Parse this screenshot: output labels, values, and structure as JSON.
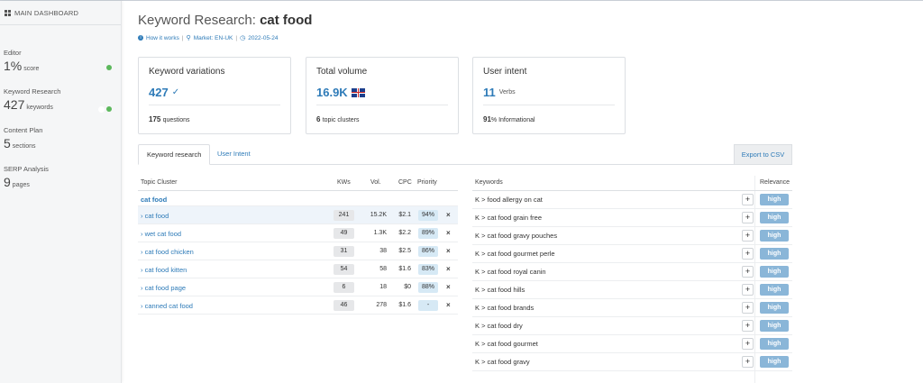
{
  "sidebar": {
    "dashboard_label": "MAIN DASHBOARD",
    "items": [
      {
        "label": "Editor",
        "value": "1%",
        "unit": "score"
      },
      {
        "label": "Keyword Research",
        "value": "427",
        "unit": "keywords"
      },
      {
        "label": "Content Plan",
        "value": "5",
        "unit": "sections"
      },
      {
        "label": "SERP Analysis",
        "value": "9",
        "unit": "pages"
      }
    ]
  },
  "header": {
    "title_prefix": "Keyword Research:",
    "title_keyword": "cat food",
    "how_it_works": "How it works",
    "market": "Market: EN-UK",
    "date": "2022-05-24"
  },
  "cards": {
    "variations": {
      "title": "Keyword variations",
      "value": "427",
      "foot_value": "175",
      "foot_unit": "questions"
    },
    "volume": {
      "title": "Total volume",
      "value": "16.9K",
      "foot_value": "6",
      "foot_unit": "topic clusters"
    },
    "intent": {
      "title": "User intent",
      "value": "11",
      "value_unit": "Verbs",
      "foot_value": "91",
      "foot_unit": "% Informational"
    }
  },
  "tabs": {
    "keyword_research": "Keyword research",
    "user_intent": "User Intent",
    "export": "Export to CSV"
  },
  "clusters": {
    "headers": {
      "topic": "Topic Cluster",
      "kws": "KWs",
      "vol": "Vol.",
      "cpc": "CPC",
      "priority": "Priority"
    },
    "group": "cat food",
    "rows": [
      {
        "name": "cat food",
        "kws": "241",
        "vol": "15.2K",
        "cpc": "$2.1",
        "priority": "94%"
      },
      {
        "name": "wet cat food",
        "kws": "49",
        "vol": "1.3K",
        "cpc": "$2.2",
        "priority": "89%"
      },
      {
        "name": "cat food chicken",
        "kws": "31",
        "vol": "38",
        "cpc": "$2.5",
        "priority": "86%"
      },
      {
        "name": "cat food kitten",
        "kws": "54",
        "vol": "58",
        "cpc": "$1.6",
        "priority": "83%"
      },
      {
        "name": "cat food page",
        "kws": "6",
        "vol": "18",
        "cpc": "$0",
        "priority": "88%"
      },
      {
        "name": "canned cat food",
        "kws": "46",
        "vol": "278",
        "cpc": "$1.6",
        "priority": "-"
      }
    ]
  },
  "keywords": {
    "headers": {
      "keywords": "Keywords",
      "relevance": "Relevance"
    },
    "rows": [
      {
        "text": "K > food allergy on cat",
        "relevance": "high"
      },
      {
        "text": "K > cat food grain free",
        "relevance": "high"
      },
      {
        "text": "K > cat food gravy pouches",
        "relevance": "high"
      },
      {
        "text": "K > cat food gourmet perle",
        "relevance": "high"
      },
      {
        "text": "K > cat food royal canin",
        "relevance": "high"
      },
      {
        "text": "K > cat food hills",
        "relevance": "high"
      },
      {
        "text": "K > cat food brands",
        "relevance": "high"
      },
      {
        "text": "K > cat food dry",
        "relevance": "high"
      },
      {
        "text": "K > cat food gourmet",
        "relevance": "high"
      },
      {
        "text": "K > cat food gravy",
        "relevance": "high"
      }
    ]
  },
  "icons": {
    "check": "check-icon",
    "info": "info-icon",
    "marker": "map-marker-icon",
    "clock": "clock-icon",
    "chevron": "chevron-right-icon",
    "plus": "plus-icon",
    "close": "close-icon",
    "flag": "uk-flag-icon"
  }
}
